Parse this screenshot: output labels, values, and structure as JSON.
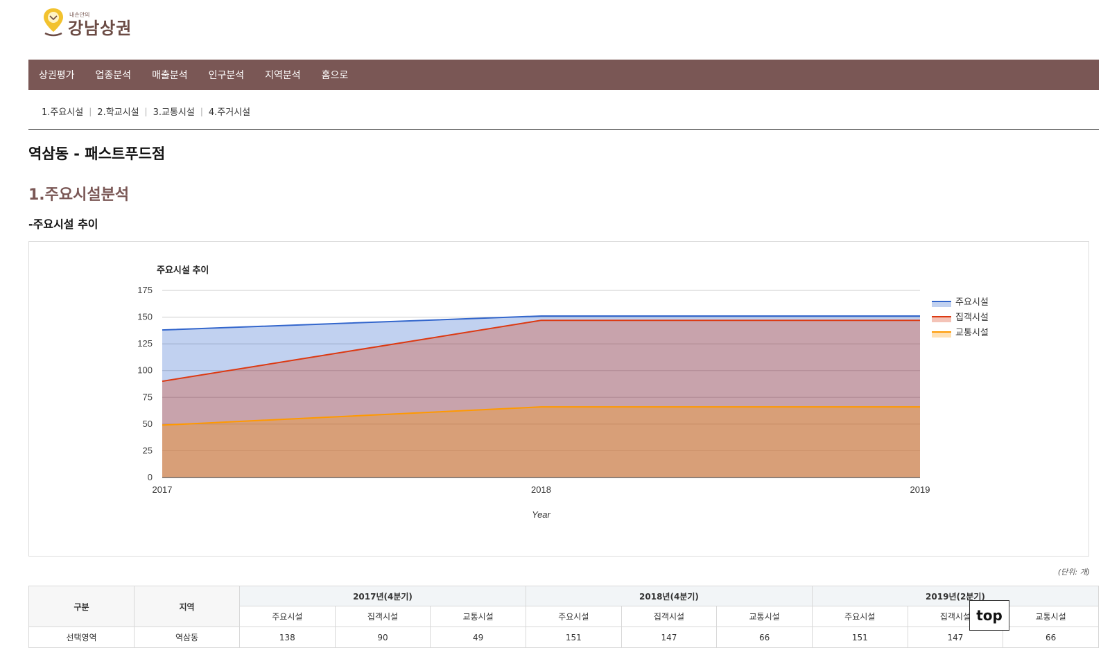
{
  "logo": {
    "sub": "내손안의",
    "main": "강남상권"
  },
  "nav": [
    {
      "label": "상권평가"
    },
    {
      "label": "업종분석"
    },
    {
      "label": "매출분석"
    },
    {
      "label": "인구분석"
    },
    {
      "label": "지역분석"
    },
    {
      "label": "홈으로"
    }
  ],
  "subnav": [
    {
      "label": "1.주요시설"
    },
    {
      "label": "2.학교시설"
    },
    {
      "label": "3.교통시설"
    },
    {
      "label": "4.주거시설"
    }
  ],
  "page_title": "역삼동 - 패스트푸드점",
  "section_title": "1.주요시설분석",
  "sub_title": "-주요시설 추이",
  "chart_data": {
    "type": "area",
    "title": "주요시설 추이",
    "xlabel": "Year",
    "ylabel": "",
    "x": [
      "2017",
      "2018",
      "2019"
    ],
    "ylim": [
      0,
      175
    ],
    "yticks": [
      0,
      25,
      50,
      75,
      100,
      125,
      150,
      175
    ],
    "grid": true,
    "legend_position": "right",
    "series": [
      {
        "name": "주요시설",
        "values": [
          138,
          151,
          151
        ],
        "color": "#3366cc"
      },
      {
        "name": "집객시설",
        "values": [
          90,
          147,
          147
        ],
        "color": "#dc3912"
      },
      {
        "name": "교통시설",
        "values": [
          49,
          66,
          66
        ],
        "color": "#ff9900"
      }
    ]
  },
  "unit_note": "(단위: 개)",
  "table": {
    "col_group": "구분",
    "col_region": "지역",
    "periods": [
      "2017년(4분기)",
      "2018년(4분기)",
      "2019년(2분기)"
    ],
    "sub_headers": [
      "주요시설",
      "집객시설",
      "교통시설"
    ],
    "rows": [
      {
        "group": "선택영역",
        "region": "역삼동",
        "values": [
          "138",
          "90",
          "49",
          "151",
          "147",
          "66",
          "151",
          "147",
          "66"
        ]
      }
    ]
  },
  "top_button": "top"
}
